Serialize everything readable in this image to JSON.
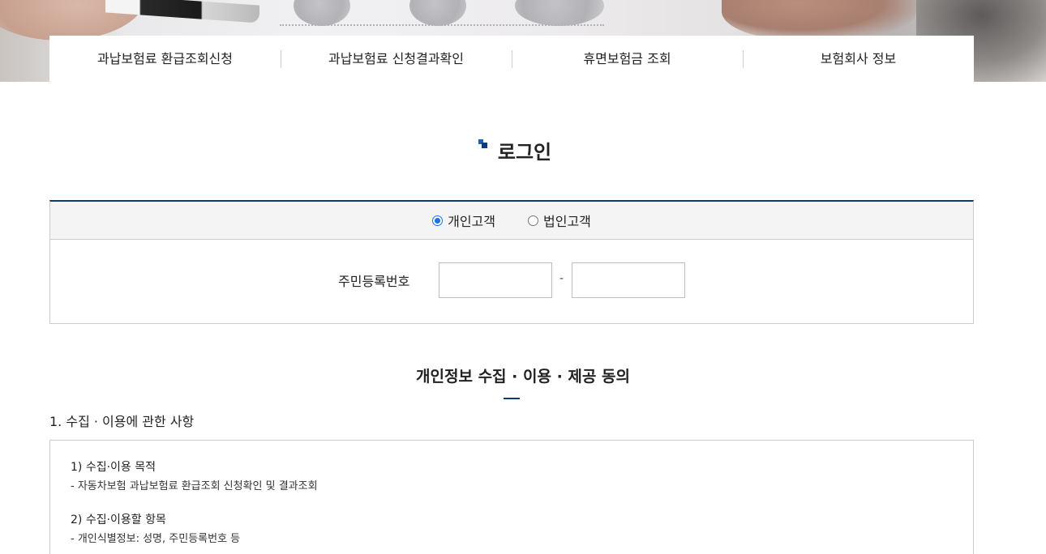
{
  "nav": {
    "items": [
      {
        "label": "과납보험료 환급조회신청"
      },
      {
        "label": "과납보험료 신청결과확인"
      },
      {
        "label": "휴면보험금 조회"
      },
      {
        "label": "보험회사 정보"
      }
    ]
  },
  "page": {
    "title": "로그인"
  },
  "login": {
    "customer_types": [
      {
        "label": "개인고객",
        "checked": true
      },
      {
        "label": "법인고객",
        "checked": false
      }
    ],
    "id_label": "주민등록번호",
    "id_first_value": "",
    "id_second_value": "",
    "separator": "-"
  },
  "consent": {
    "title": "개인정보 수집 · 이용 · 제공 동의",
    "section_heading": "1. 수집 · 이용에 관한 사항",
    "items": [
      {
        "title": "1) 수집·이용 목적",
        "line": "-  자동차보험 과납보험료 환급조회 신청확인 및 결과조회"
      },
      {
        "title": "2) 수집·이용할 항목",
        "line": "-  개인식별정보: 성명, 주민등록번호 등"
      }
    ]
  },
  "colors": {
    "accent": "#0f3a7a",
    "radio_checked": "#1a73e8",
    "panel_bg": "#f4f4f4",
    "border": "#cccccc"
  }
}
